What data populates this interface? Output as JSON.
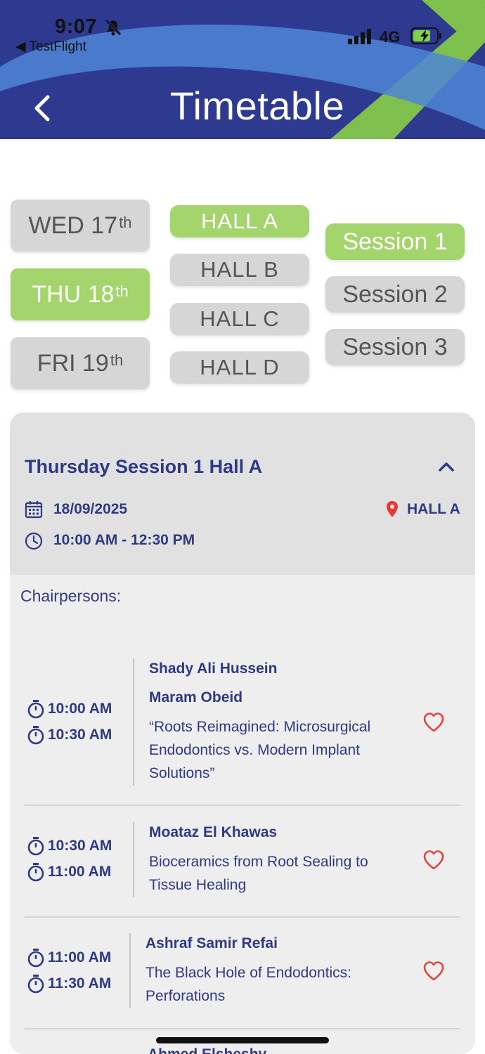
{
  "status_bar": {
    "time": "9:07",
    "back_app": "◀ TestFlight",
    "network": "4G"
  },
  "header": {
    "title": "Timetable",
    "colors": {
      "bg": "#2e3990",
      "blue_stripe": "#4e86d6",
      "green_stripe": "#7fbf4d"
    }
  },
  "days": [
    {
      "label": "WED 17",
      "suffix": "th",
      "active": false
    },
    {
      "label": "THU 18",
      "suffix": "th",
      "active": true
    },
    {
      "label": "FRI 19",
      "suffix": "th",
      "active": false
    }
  ],
  "halls": [
    {
      "label": "HALL A",
      "active": true
    },
    {
      "label": "HALL B",
      "active": false
    },
    {
      "label": "HALL C",
      "active": false
    },
    {
      "label": "HALL D",
      "active": false
    }
  ],
  "sessions": [
    {
      "label": "Session 1",
      "active": true
    },
    {
      "label": "Session 2",
      "active": false
    },
    {
      "label": "Session 3",
      "active": false
    }
  ],
  "accent_colors": {
    "active_pill": "#a4d46c",
    "inactive_pill": "#d6d6d6",
    "text_navy": "#2e3a86",
    "heart": "#e0483c",
    "pin": "#e53935"
  },
  "session_card": {
    "title": "Thursday Session 1 Hall A",
    "date": "18/09/2025",
    "location": "HALL A",
    "time_range": "10:00 AM - 12:30 PM",
    "chairpersons_label": "Chairpersons:",
    "talks": [
      {
        "start": "10:00 AM",
        "end": "10:30 AM",
        "speakers": [
          "Shady Ali Hussein",
          "Maram Obeid"
        ],
        "title_lines": [
          "“Roots Reimagined: Microsurgical",
          "Endodontics vs. Modern Implant",
          "Solutions”"
        ]
      },
      {
        "start": "10:30 AM",
        "end": "11:00 AM",
        "speakers": [
          "Moataz El Khawas"
        ],
        "title_lines": [
          "Bioceramics from Root Sealing to",
          "Tissue Healing"
        ]
      },
      {
        "start": "11:00 AM",
        "end": "11:30 AM",
        "speakers": [
          "Ashraf Samir Refai"
        ],
        "title_lines": [
          "The Black Hole of Endodontics:",
          "Perforations"
        ]
      },
      {
        "speakers": [
          "Ahmed Elsheshy"
        ]
      }
    ]
  }
}
